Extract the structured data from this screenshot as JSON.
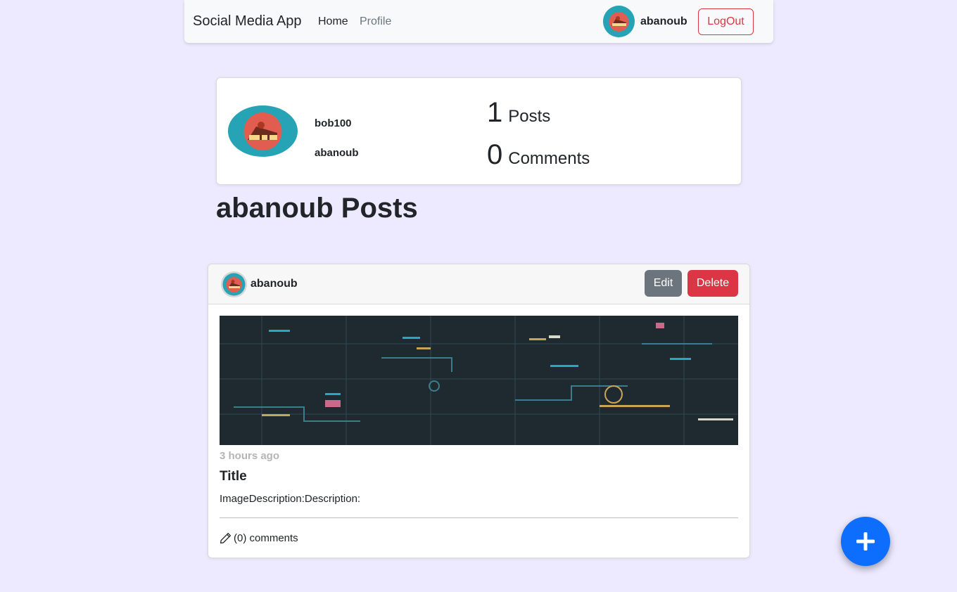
{
  "navbar": {
    "brand": "Social Media App",
    "links": [
      "Home",
      "Profile"
    ],
    "username": "abanoub",
    "logout_label": "LogOut"
  },
  "profile": {
    "handle": "bob100",
    "name": "abanoub",
    "posts_count": "1",
    "posts_label": "Posts",
    "comments_count": "0",
    "comments_label": "Comments"
  },
  "section_title": "abanoub Posts",
  "post": {
    "author": "abanoub",
    "edit_label": "Edit",
    "delete_label": "Delete",
    "time": "3 hours ago",
    "title": "Title",
    "description": "ImageDescription:Description:",
    "comments_label": "(0) comments",
    "image_icon": "circuit-board-image"
  },
  "fab_icon": "plus-icon",
  "colors": {
    "background": "#ede9fe",
    "primary": "#0d6efd",
    "danger": "#dc3545",
    "secondary": "#6c757d",
    "avatar_bg": "#26a3b5",
    "avatar_inner": "#e05d4f"
  }
}
